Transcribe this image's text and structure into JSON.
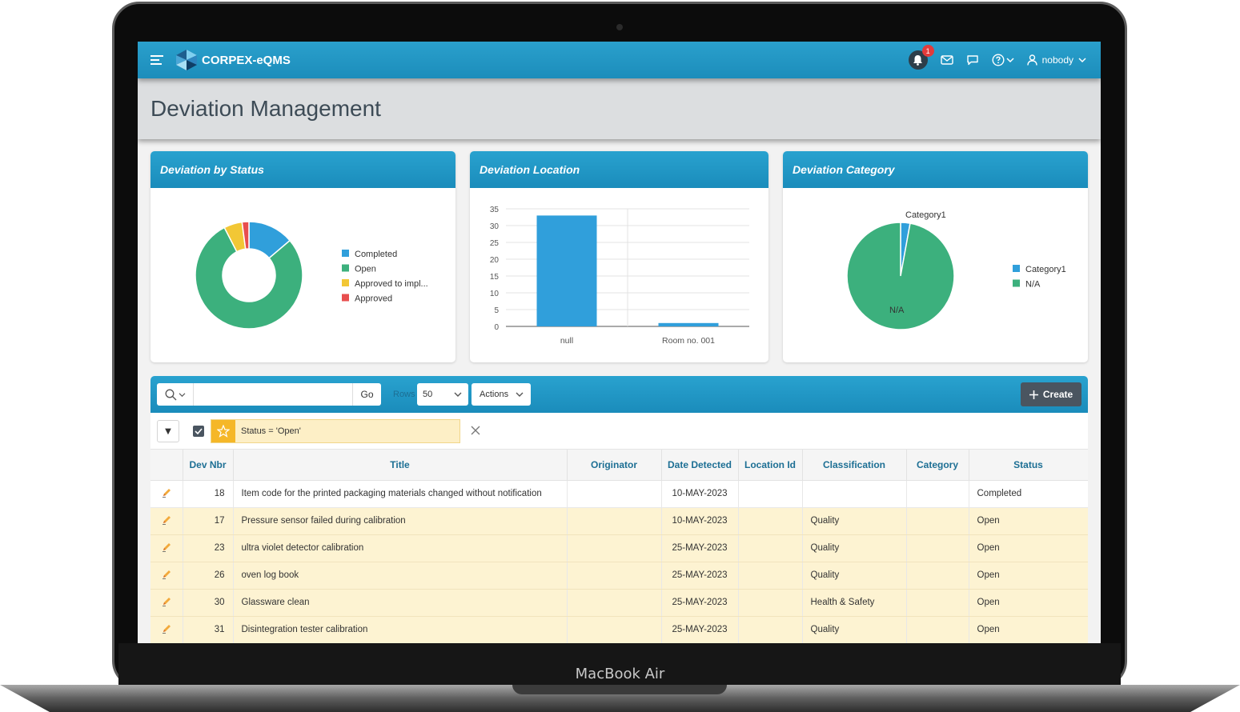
{
  "device": {
    "brand_label": "MacBook Air"
  },
  "header": {
    "app_title": "CORPEX-eQMS",
    "notification_count": "1",
    "user_name": "nobody"
  },
  "page": {
    "title": "Deviation Management"
  },
  "cards": {
    "status": {
      "title": "Deviation by Status",
      "chart_data": {
        "type": "pie",
        "categories": [
          "Completed",
          "Open",
          "Approved to impl...",
          "Approved"
        ],
        "values": [
          1,
          5.7,
          0.4,
          0.15
        ],
        "colors": [
          "#309fdb",
          "#3cb07d",
          "#f2c735",
          "#e84e4e"
        ],
        "donut": true,
        "legend": "right"
      }
    },
    "location": {
      "title": "Deviation Location",
      "chart_data": {
        "type": "bar",
        "categories": [
          "null",
          "Room no. 001"
        ],
        "values": [
          33,
          1
        ],
        "ylim": [
          0,
          35
        ],
        "yticks": [
          0,
          5,
          10,
          15,
          20,
          25,
          30,
          35
        ],
        "color": "#309fdb",
        "grid": true
      }
    },
    "category": {
      "title": "Deviation Category",
      "chart_data": {
        "type": "pie",
        "categories": [
          "Category1",
          "N/A"
        ],
        "values": [
          1,
          34
        ],
        "colors": [
          "#309fdb",
          "#3cb07d"
        ],
        "data_labels": [
          "Category1",
          "N/A"
        ],
        "legend": "right"
      }
    }
  },
  "report": {
    "search_placeholder": "",
    "go_label": "Go",
    "rows_label": "Rows",
    "rows_value": "50",
    "actions_label": "Actions",
    "create_label": "Create",
    "filter_text": "Status = 'Open'",
    "columns": [
      "",
      "Dev Nbr",
      "Title",
      "Originator",
      "Date Detected",
      "Location Id",
      "Classification",
      "Category",
      "Status"
    ],
    "rows": [
      {
        "dev_nbr": "18",
        "title": "Item code for the printed packaging materials changed without notification",
        "originator": "",
        "date": "10-MAY-2023",
        "location": "",
        "classification": "",
        "category": "",
        "status": "Completed",
        "highlight": false
      },
      {
        "dev_nbr": "17",
        "title": "Pressure sensor failed during calibration",
        "originator": "",
        "date": "10-MAY-2023",
        "location": "",
        "classification": "Quality",
        "category": "",
        "status": "Open",
        "highlight": true
      },
      {
        "dev_nbr": "23",
        "title": "ultra violet detector calibration",
        "originator": "",
        "date": "25-MAY-2023",
        "location": "",
        "classification": "Quality",
        "category": "",
        "status": "Open",
        "highlight": true
      },
      {
        "dev_nbr": "26",
        "title": "oven log book",
        "originator": "",
        "date": "25-MAY-2023",
        "location": "",
        "classification": "Quality",
        "category": "",
        "status": "Open",
        "highlight": true
      },
      {
        "dev_nbr": "30",
        "title": "Glassware clean",
        "originator": "",
        "date": "25-MAY-2023",
        "location": "",
        "classification": "Health & Safety",
        "category": "",
        "status": "Open",
        "highlight": true
      },
      {
        "dev_nbr": "31",
        "title": "Disintegration tester calibration",
        "originator": "",
        "date": "25-MAY-2023",
        "location": "",
        "classification": "Quality",
        "category": "",
        "status": "Open",
        "highlight": true
      }
    ]
  }
}
